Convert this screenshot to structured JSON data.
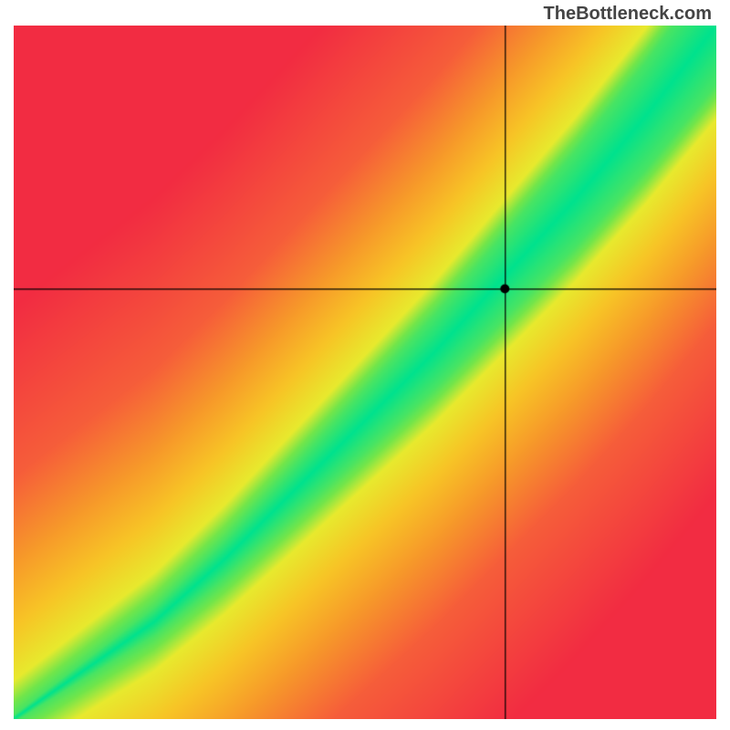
{
  "watermark": "TheBottleneck.com",
  "chart_data": {
    "type": "heatmap",
    "title": "",
    "xlabel": "",
    "ylabel": "",
    "xlim": [
      0,
      1
    ],
    "ylim": [
      0,
      1
    ],
    "crosshair": {
      "x": 0.7,
      "y": 0.62
    },
    "marker": {
      "x": 0.7,
      "y": 0.62
    },
    "optimal_band": {
      "description": "green diagonal band where y ≈ f(x); slight S-curve",
      "control_points": [
        {
          "x": 0.0,
          "y": 0.0
        },
        {
          "x": 0.1,
          "y": 0.07
        },
        {
          "x": 0.2,
          "y": 0.14
        },
        {
          "x": 0.3,
          "y": 0.23
        },
        {
          "x": 0.4,
          "y": 0.33
        },
        {
          "x": 0.5,
          "y": 0.43
        },
        {
          "x": 0.6,
          "y": 0.53
        },
        {
          "x": 0.7,
          "y": 0.64
        },
        {
          "x": 0.8,
          "y": 0.75
        },
        {
          "x": 0.9,
          "y": 0.87
        },
        {
          "x": 1.0,
          "y": 1.0
        }
      ],
      "half_width_at_x0": 0.005,
      "half_width_at_x1": 0.085
    },
    "color_stops": [
      {
        "dist": 0.0,
        "color": "#00e28e"
      },
      {
        "dist": 0.08,
        "color": "#74e64a"
      },
      {
        "dist": 0.13,
        "color": "#e8ea2e"
      },
      {
        "dist": 0.25,
        "color": "#f7c626"
      },
      {
        "dist": 0.4,
        "color": "#f79a2a"
      },
      {
        "dist": 0.6,
        "color": "#f65e3a"
      },
      {
        "dist": 1.0,
        "color": "#f22c42"
      }
    ]
  }
}
